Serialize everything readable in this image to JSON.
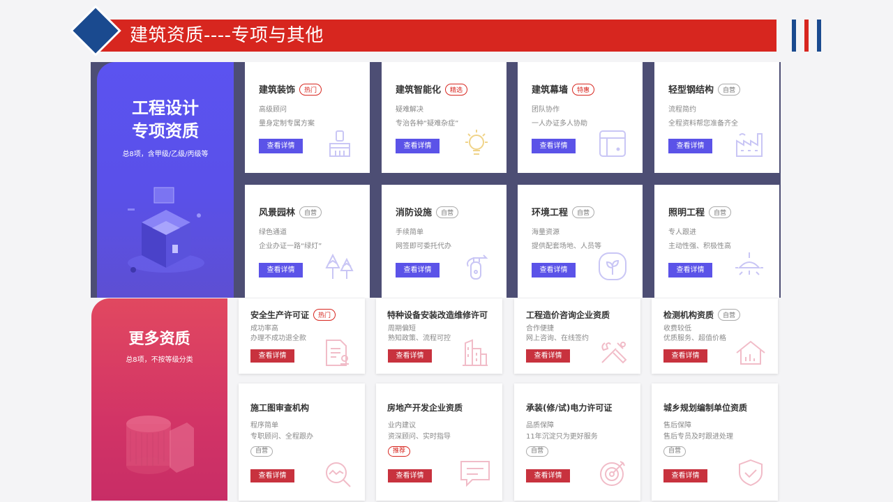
{
  "header": {
    "title": "建筑资质----专项与其他",
    "colors": {
      "bar": "#d7261f",
      "diamond": "#1a4a8f",
      "stripes": [
        "#1a4a8f",
        "#d7261f",
        "#1a4a8f"
      ]
    }
  },
  "top": {
    "side_title_1": "工程设计",
    "side_title_2": "专项资质",
    "side_sub": "总8项，含甲级/乙级/丙级等",
    "button_label": "查看详情",
    "cards": [
      {
        "title": "建筑装饰",
        "badge": "热门",
        "badge_style": "red",
        "line1": "高级顾问",
        "line2": "量身定制专属方案",
        "icon": "brush-icon"
      },
      {
        "title": "建筑智能化",
        "badge": "精选",
        "badge_style": "red",
        "line1": "疑难解决",
        "line2": "专治各种“疑难杂症”",
        "icon": "lightbulb-icon"
      },
      {
        "title": "建筑幕墙",
        "badge": "特惠",
        "badge_style": "red",
        "line1": "团队协作",
        "line2": "一人办证多人协助",
        "icon": "window-icon"
      },
      {
        "title": "轻型钢结构",
        "badge": "自营",
        "badge_style": "gray",
        "line1": "流程简约",
        "line2": "全程资料帮您准备齐全",
        "icon": "factory-icon"
      },
      {
        "title": "风景园林",
        "badge": "自营",
        "badge_style": "gray",
        "line1": "绿色通道",
        "line2": "企业办证一路“绿灯”",
        "icon": "trees-icon"
      },
      {
        "title": "消防设施",
        "badge": "自营",
        "badge_style": "gray",
        "line1": "手续简单",
        "line2": "网签即可委托代办",
        "icon": "fire-extinguisher-icon"
      },
      {
        "title": "环境工程",
        "badge": "自营",
        "badge_style": "gray",
        "line1": "海量资源",
        "line2": "提供配套场地、人员等",
        "icon": "leaf-icon"
      },
      {
        "title": "照明工程",
        "badge": "自营",
        "badge_style": "gray",
        "line1": "专人跟进",
        "line2": "主动性强、积极性高",
        "icon": "lamp-icon"
      }
    ]
  },
  "bottom": {
    "side_title": "更多资质",
    "side_sub": "总8项，不按等级分类",
    "button_label": "查看详情",
    "cards": [
      {
        "title": "安全生产许可证",
        "badge": "热门",
        "badge_style": "red",
        "line1": "成功率高",
        "line2": "办理不成功退全款",
        "icon": "document-stamp-icon"
      },
      {
        "title": "特种设备安装改造维修许可",
        "badge": "",
        "badge_style": "",
        "line1": "周期偏短",
        "line2": "熟知政策、流程可控",
        "icon": "buildings-icon"
      },
      {
        "title": "工程造价咨询企业资质",
        "badge": "",
        "badge_style": "",
        "line1": "合作便捷",
        "line2": "网上咨询、在线签约",
        "icon": "tools-icon"
      },
      {
        "title": "检测机构资质",
        "badge": "自营",
        "badge_style": "gray",
        "line1": "收费较低",
        "line2": "优质服务、超值价格",
        "icon": "house-chart-icon"
      },
      {
        "title": "施工图审查机构",
        "tag": "自营",
        "tag_style": "gray",
        "line1": "程序简单",
        "line2": "专职顾问、全程跟办",
        "icon": "magnifier-chart-icon"
      },
      {
        "title": "房地产开发企业资质",
        "tag": "推荐",
        "tag_style": "red",
        "line1": "业内建议",
        "line2": "资深顾问、实时指导",
        "icon": "message-icon"
      },
      {
        "title": "承装(修/试)电力许可证",
        "tag": "自营",
        "tag_style": "gray",
        "line1": "品质保障",
        "line2": "11年沉淀只为更好服务",
        "icon": "target-icon"
      },
      {
        "title": "城乡规划编制单位资质",
        "tag": "自营",
        "tag_style": "gray",
        "line1": "售后保障",
        "line2": "售后专员及时跟进处理",
        "icon": "shield-check-icon"
      }
    ]
  }
}
